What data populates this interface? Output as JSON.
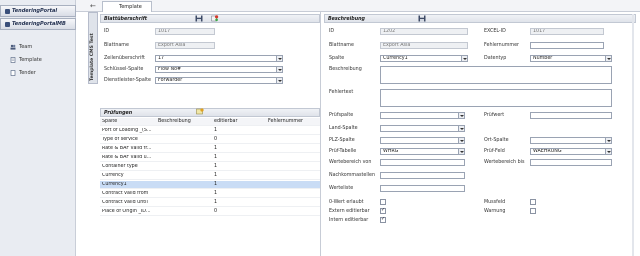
{
  "nav": {
    "portals": [
      "TenderingPortal",
      "TenderingPortalMB"
    ],
    "items": [
      "Team",
      "Template",
      "Tender"
    ],
    "vertical_tab": "Template CMS Test"
  },
  "tab": {
    "label": "Template"
  },
  "left": {
    "header": "Blattüberschrift",
    "id_label": "ID",
    "id_value": "1017",
    "blattname_label": "Blattname",
    "blattname_value": "Export Asia",
    "zeile_label": "Zeilenüberschrift",
    "zeile_value": "17",
    "schluessel_label": "Schlüssel-Spalte",
    "schluessel_value": "Flow No#",
    "dienst_label": "Dienstleister-Spalte",
    "dienst_value": "Forwarder"
  },
  "pruef": {
    "header": "Prüfungen",
    "columns": [
      "Spalte",
      "Beschreibung",
      "editierbar",
      "Fehlernummer"
    ],
    "rows": [
      {
        "spalte": "Port of Loading _(S...",
        "editierbar": "1"
      },
      {
        "spalte": "Type of service",
        "editierbar": "0"
      },
      {
        "spalte": "Rate & BAF valid fr...",
        "editierbar": "1"
      },
      {
        "spalte": "Rate & BAF valid u...",
        "editierbar": "1"
      },
      {
        "spalte": "Container type",
        "editierbar": "1"
      },
      {
        "spalte": "Currency",
        "editierbar": "1"
      },
      {
        "spalte": "Currency1",
        "editierbar": "1"
      },
      {
        "spalte": "Contract valid from",
        "editierbar": "1"
      },
      {
        "spalte": "Contract valid until",
        "editierbar": "1"
      },
      {
        "spalte": "Place of Origin _ID...",
        "editierbar": "0"
      }
    ],
    "selected_index": 6
  },
  "right": {
    "header": "Beschreibung",
    "id_label": "ID",
    "id_value": "1202",
    "excel_label": "EXCEL-ID",
    "excel_value": "1017",
    "blattname_label": "Blattname",
    "blattname_value": "Export Asia",
    "fehlernummer_label": "Fehlernummer",
    "fehlernummer_value": "",
    "spalte_label": "Spalte",
    "spalte_value": "Currency1",
    "datentyp_label": "Datentyp",
    "datentyp_value": "Number",
    "beschreibung_label": "Beschreibung",
    "fehlertext_label": "Fehlertext",
    "pruefspalte_label": "Prüfspalte",
    "pruefspalte_value": "",
    "pruefwert_label": "Prüfwert",
    "pruefwert_value": "",
    "land_label": "Land-Spalte",
    "land_value": "",
    "plz_label": "PLZ-Spalte",
    "plz_value": "",
    "ort_label": "Ort-Spalte",
    "ort_value": "",
    "prueftabelle_label": "Prüf-Tabelle",
    "prueftabelle_value": "WHRG",
    "prueffeld_label": "Prüf-Feld",
    "prueffeld_value": "WAEHRUNG",
    "wvon_label": "Wertebereich von",
    "wvon_value": "",
    "wbis_label": "Wertebereich bis",
    "wbis_value": "",
    "nachkomma_label": "Nachkommastellen",
    "nachkomma_value": "",
    "werteliste_label": "Werteliste",
    "werteliste_value": "",
    "nullwert_label": "0-Wert erlaubt",
    "muss_label": "Mussfeld",
    "extern_label": "Extern editierbar",
    "warnung_label": "Warnung",
    "intern_label": "Intern editierbar"
  },
  "colors": {
    "accent": "#3a4f7a",
    "selection": "#c9dcf5"
  }
}
